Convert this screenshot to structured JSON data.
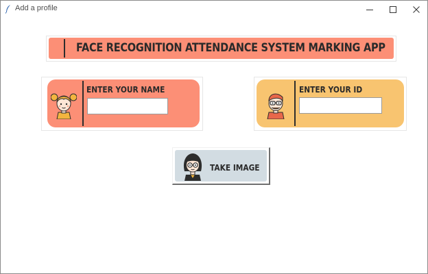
{
  "window": {
    "title": "Add a profile",
    "icon": "feather-icon",
    "controls": [
      "minimize-icon",
      "maximize-icon",
      "close-icon"
    ]
  },
  "banner": {
    "title": "FACE RECOGNITION ATTENDANCE SYSTEM MARKING APP",
    "color": "#fc8f76"
  },
  "name_card": {
    "label": "ENTER YOUR NAME",
    "value": "",
    "color": "#fc8f76",
    "avatar": "girl-avatar-icon"
  },
  "id_card": {
    "label": "ENTER YOUR ID",
    "value": "",
    "color": "#f8c470",
    "avatar": "boy-avatar-icon"
  },
  "take_image": {
    "label": "TAKE IMAGE",
    "color": "#d2dce2",
    "avatar": "person-avatar-icon"
  }
}
